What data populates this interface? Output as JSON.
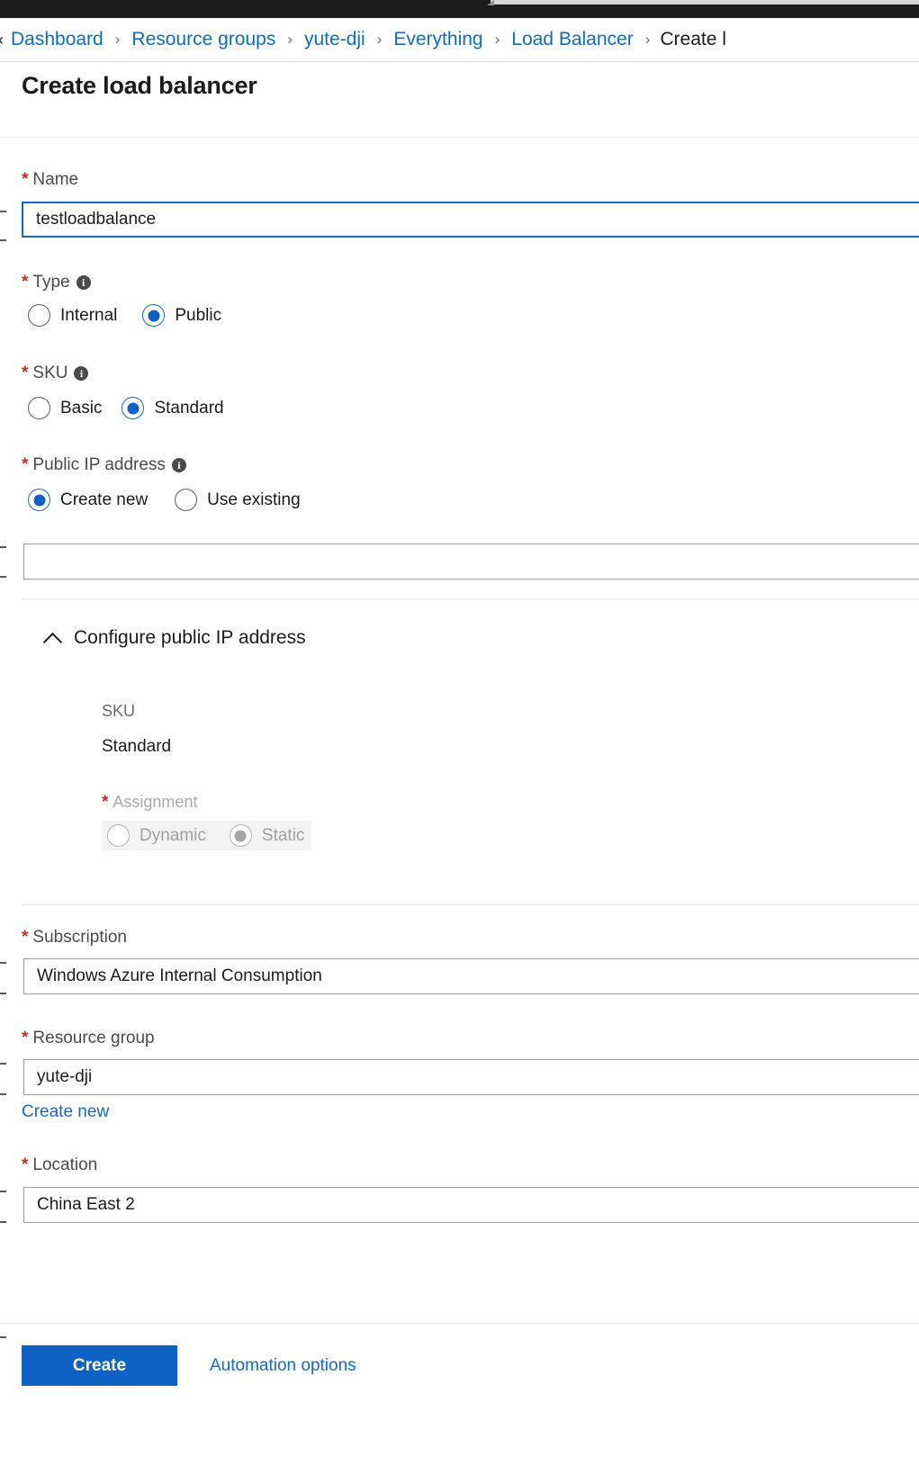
{
  "breadcrumb": {
    "collapse_icon": "double-chevron-left-icon",
    "separator": "›",
    "items": [
      {
        "label": "Dashboard",
        "current": false
      },
      {
        "label": "Resource groups",
        "current": false
      },
      {
        "label": "yute-dji",
        "current": false
      },
      {
        "label": "Everything",
        "current": false
      },
      {
        "label": "Load Balancer",
        "current": false
      },
      {
        "label": "Create l",
        "current": true
      }
    ]
  },
  "page": {
    "title": "Create load balancer"
  },
  "form": {
    "name": {
      "label": "Name",
      "required_marker": "*",
      "value": "testloadbalance",
      "placeholder": ""
    },
    "type": {
      "label": "Type",
      "required_marker": "*",
      "info_icon": "info-icon",
      "options": [
        "Internal",
        "Public"
      ],
      "selected": "Public"
    },
    "sku": {
      "label": "SKU",
      "required_marker": "*",
      "info_icon": "info-icon",
      "options": [
        "Basic",
        "Standard"
      ],
      "selected": "Standard"
    },
    "public_ip": {
      "label": "Public IP address",
      "required_marker": "*",
      "info_icon": "info-icon",
      "options": [
        "Create new",
        "Use existing"
      ],
      "selected": "Create new",
      "name_value": "",
      "name_placeholder": ""
    },
    "configure_public_ip": {
      "chevron_icon": "chevron-up-icon",
      "title": "Configure public IP address",
      "sku_label": "SKU",
      "sku_value": "Standard",
      "assignment": {
        "label": "Assignment",
        "required_marker": "*",
        "options": [
          "Dynamic",
          "Static"
        ],
        "selected": "Static",
        "disabled": true
      }
    },
    "subscription": {
      "label": "Subscription",
      "required_marker": "*",
      "value": "Windows Azure Internal Consumption"
    },
    "resource_group": {
      "label": "Resource group",
      "required_marker": "*",
      "value": "yute-dji",
      "create_new_link": "Create new"
    },
    "location": {
      "label": "Location",
      "required_marker": "*",
      "value": "China East 2"
    }
  },
  "footer": {
    "create_label": "Create",
    "automation_label": "Automation options"
  },
  "colors": {
    "accent": "#0f62c4",
    "link": "#1569c7",
    "required": "#c52b2b",
    "chrome_dark": "#1b1b1b"
  }
}
